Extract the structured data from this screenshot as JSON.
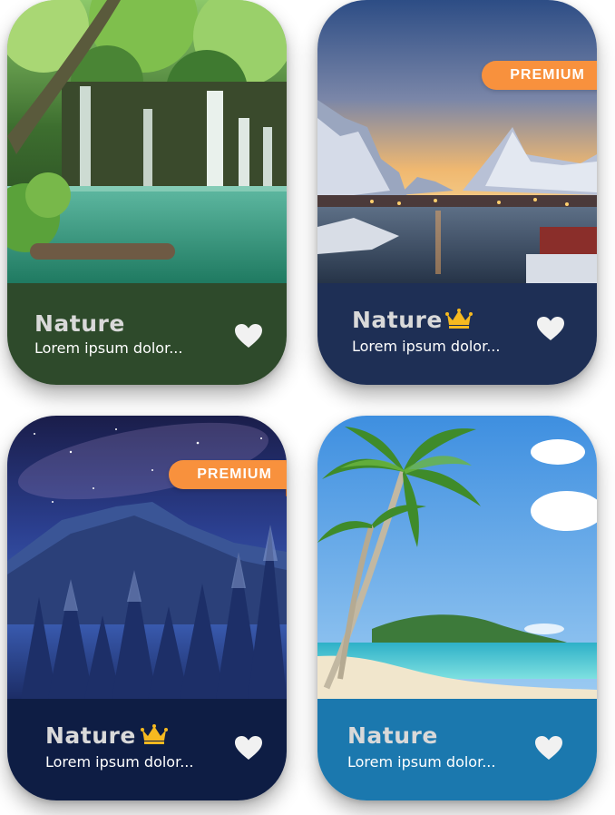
{
  "cards": [
    {
      "title": "Nature",
      "subtitle": "Lorem ipsum dolor...",
      "premium": false,
      "scene": "waterfall-icon",
      "footer_color": "#2e4a2b"
    },
    {
      "title": "Nature",
      "subtitle": "Lorem ipsum dolor...",
      "premium": true,
      "badge": "PREMIUM",
      "scene": "mountain-harbor-icon",
      "footer_color": "#1e2f55"
    },
    {
      "title": "Nature",
      "subtitle": "Lorem ipsum dolor...",
      "premium": true,
      "badge": "PREMIUM",
      "scene": "night-forest-icon",
      "footer_color": "#0e1d44"
    },
    {
      "title": "Nature",
      "subtitle": "Lorem ipsum dolor...",
      "premium": false,
      "scene": "beach-palm-icon",
      "footer_color": "#1b78ae"
    }
  ],
  "colors": {
    "premium_badge": "#f8913d",
    "crown": "#f6b920",
    "heart": "#f1f1f1"
  }
}
